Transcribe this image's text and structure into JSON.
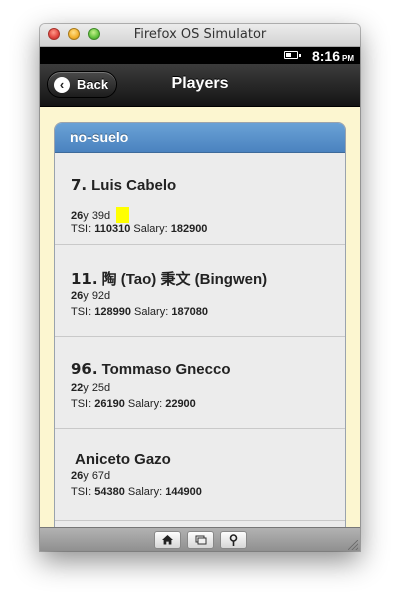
{
  "window": {
    "title": "Firefox OS Simulator"
  },
  "status": {
    "time": "8:16",
    "ampm": "PM"
  },
  "nav": {
    "back_label": "Back",
    "title": "Players"
  },
  "team": {
    "name": "no-suelo"
  },
  "players": [
    {
      "number": "7.",
      "name": "Luis Cabelo",
      "age_years": "26",
      "age_days": "39d",
      "tsi": "110310",
      "salary": "182900",
      "marker": true
    },
    {
      "number": "11.",
      "name": "陶 (Tao) 秉文 (Bingwen)",
      "age_years": "26",
      "age_days": "92d",
      "tsi": "128990",
      "salary": "187080"
    },
    {
      "number": "96.",
      "name": "Tommaso Gnecco",
      "age_years": "22",
      "age_days": "25d",
      "tsi": "26190",
      "salary": "22900"
    },
    {
      "number": "",
      "name": "Aniceto Gazo",
      "age_years": "26",
      "age_days": "67d",
      "tsi": "54380",
      "salary": "144900"
    }
  ],
  "labels": {
    "years_suffix": "y",
    "tsi": "TSI:",
    "salary": "Salary:"
  },
  "toolbar": {
    "icons": [
      "home-icon",
      "windows-icon",
      "location-pin-icon"
    ]
  },
  "colors": {
    "panel_header": "#5a92cb",
    "content_bg": "#fcf6d0",
    "marker": "#ffff00"
  }
}
